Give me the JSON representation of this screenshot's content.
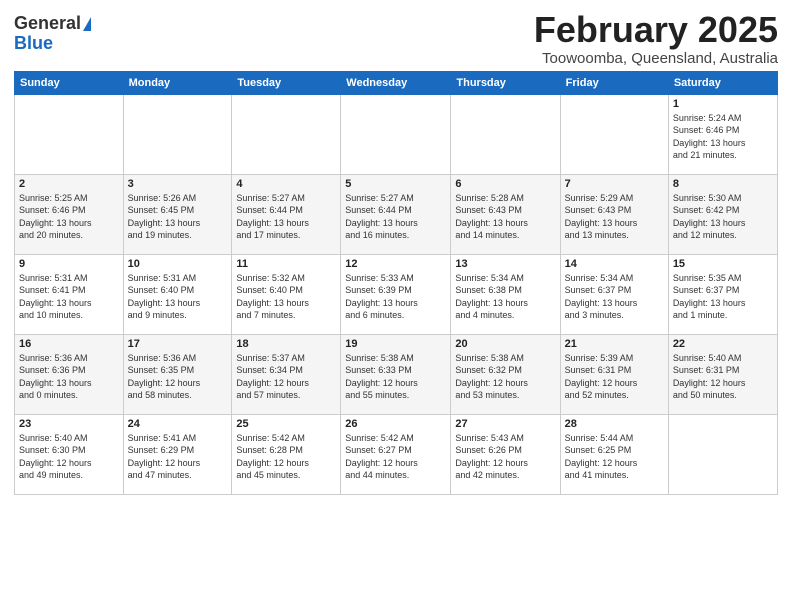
{
  "logo": {
    "general": "General",
    "blue": "Blue"
  },
  "title": {
    "month": "February 2025",
    "location": "Toowoomba, Queensland, Australia"
  },
  "headers": [
    "Sunday",
    "Monday",
    "Tuesday",
    "Wednesday",
    "Thursday",
    "Friday",
    "Saturday"
  ],
  "weeks": [
    {
      "days": [
        {
          "num": "",
          "info": ""
        },
        {
          "num": "",
          "info": ""
        },
        {
          "num": "",
          "info": ""
        },
        {
          "num": "",
          "info": ""
        },
        {
          "num": "",
          "info": ""
        },
        {
          "num": "",
          "info": ""
        },
        {
          "num": "1",
          "info": "Sunrise: 5:24 AM\nSunset: 6:46 PM\nDaylight: 13 hours\nand 21 minutes."
        }
      ]
    },
    {
      "days": [
        {
          "num": "2",
          "info": "Sunrise: 5:25 AM\nSunset: 6:46 PM\nDaylight: 13 hours\nand 20 minutes."
        },
        {
          "num": "3",
          "info": "Sunrise: 5:26 AM\nSunset: 6:45 PM\nDaylight: 13 hours\nand 19 minutes."
        },
        {
          "num": "4",
          "info": "Sunrise: 5:27 AM\nSunset: 6:44 PM\nDaylight: 13 hours\nand 17 minutes."
        },
        {
          "num": "5",
          "info": "Sunrise: 5:27 AM\nSunset: 6:44 PM\nDaylight: 13 hours\nand 16 minutes."
        },
        {
          "num": "6",
          "info": "Sunrise: 5:28 AM\nSunset: 6:43 PM\nDaylight: 13 hours\nand 14 minutes."
        },
        {
          "num": "7",
          "info": "Sunrise: 5:29 AM\nSunset: 6:43 PM\nDaylight: 13 hours\nand 13 minutes."
        },
        {
          "num": "8",
          "info": "Sunrise: 5:30 AM\nSunset: 6:42 PM\nDaylight: 13 hours\nand 12 minutes."
        }
      ]
    },
    {
      "days": [
        {
          "num": "9",
          "info": "Sunrise: 5:31 AM\nSunset: 6:41 PM\nDaylight: 13 hours\nand 10 minutes."
        },
        {
          "num": "10",
          "info": "Sunrise: 5:31 AM\nSunset: 6:40 PM\nDaylight: 13 hours\nand 9 minutes."
        },
        {
          "num": "11",
          "info": "Sunrise: 5:32 AM\nSunset: 6:40 PM\nDaylight: 13 hours\nand 7 minutes."
        },
        {
          "num": "12",
          "info": "Sunrise: 5:33 AM\nSunset: 6:39 PM\nDaylight: 13 hours\nand 6 minutes."
        },
        {
          "num": "13",
          "info": "Sunrise: 5:34 AM\nSunset: 6:38 PM\nDaylight: 13 hours\nand 4 minutes."
        },
        {
          "num": "14",
          "info": "Sunrise: 5:34 AM\nSunset: 6:37 PM\nDaylight: 13 hours\nand 3 minutes."
        },
        {
          "num": "15",
          "info": "Sunrise: 5:35 AM\nSunset: 6:37 PM\nDaylight: 13 hours\nand 1 minute."
        }
      ]
    },
    {
      "days": [
        {
          "num": "16",
          "info": "Sunrise: 5:36 AM\nSunset: 6:36 PM\nDaylight: 13 hours\nand 0 minutes."
        },
        {
          "num": "17",
          "info": "Sunrise: 5:36 AM\nSunset: 6:35 PM\nDaylight: 12 hours\nand 58 minutes."
        },
        {
          "num": "18",
          "info": "Sunrise: 5:37 AM\nSunset: 6:34 PM\nDaylight: 12 hours\nand 57 minutes."
        },
        {
          "num": "19",
          "info": "Sunrise: 5:38 AM\nSunset: 6:33 PM\nDaylight: 12 hours\nand 55 minutes."
        },
        {
          "num": "20",
          "info": "Sunrise: 5:38 AM\nSunset: 6:32 PM\nDaylight: 12 hours\nand 53 minutes."
        },
        {
          "num": "21",
          "info": "Sunrise: 5:39 AM\nSunset: 6:31 PM\nDaylight: 12 hours\nand 52 minutes."
        },
        {
          "num": "22",
          "info": "Sunrise: 5:40 AM\nSunset: 6:31 PM\nDaylight: 12 hours\nand 50 minutes."
        }
      ]
    },
    {
      "days": [
        {
          "num": "23",
          "info": "Sunrise: 5:40 AM\nSunset: 6:30 PM\nDaylight: 12 hours\nand 49 minutes."
        },
        {
          "num": "24",
          "info": "Sunrise: 5:41 AM\nSunset: 6:29 PM\nDaylight: 12 hours\nand 47 minutes."
        },
        {
          "num": "25",
          "info": "Sunrise: 5:42 AM\nSunset: 6:28 PM\nDaylight: 12 hours\nand 45 minutes."
        },
        {
          "num": "26",
          "info": "Sunrise: 5:42 AM\nSunset: 6:27 PM\nDaylight: 12 hours\nand 44 minutes."
        },
        {
          "num": "27",
          "info": "Sunrise: 5:43 AM\nSunset: 6:26 PM\nDaylight: 12 hours\nand 42 minutes."
        },
        {
          "num": "28",
          "info": "Sunrise: 5:44 AM\nSunset: 6:25 PM\nDaylight: 12 hours\nand 41 minutes."
        },
        {
          "num": "",
          "info": ""
        }
      ]
    }
  ]
}
